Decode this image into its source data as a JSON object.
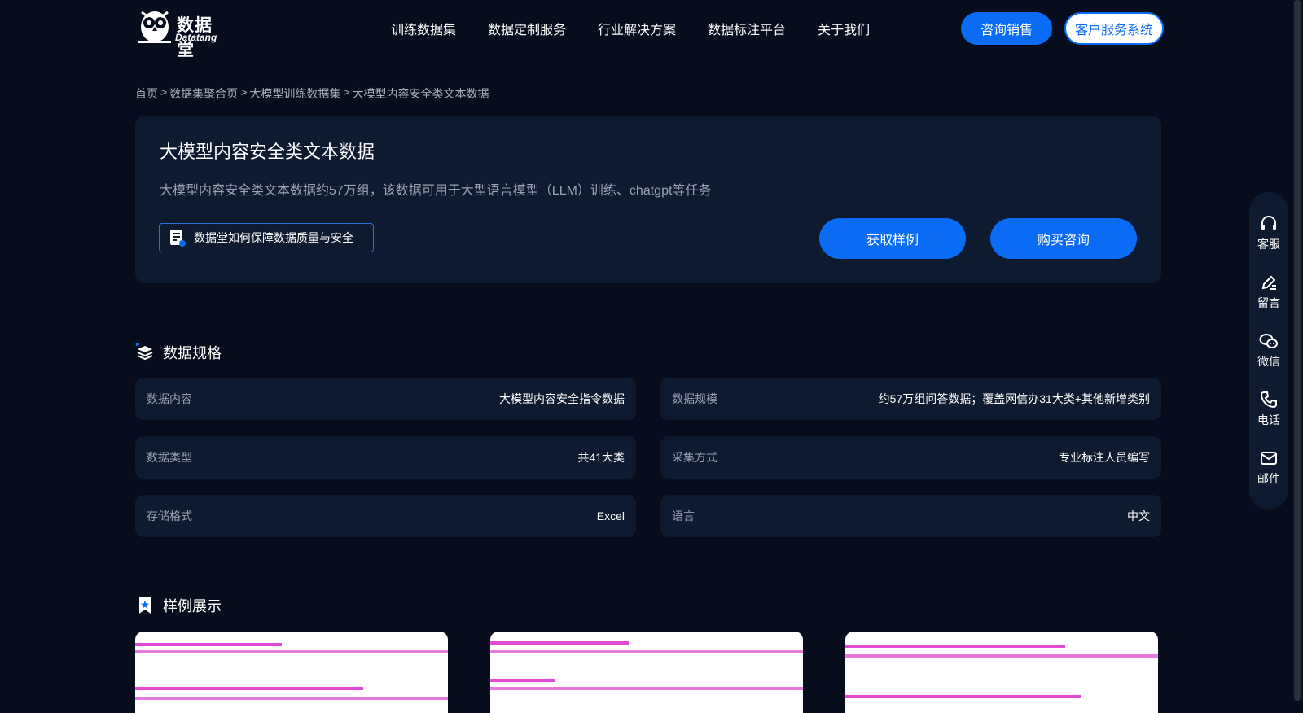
{
  "brand": {
    "name_cn": "数据堂",
    "name_en": "Datatang"
  },
  "nav": [
    "训练数据集",
    "数据定制服务",
    "行业解决方案",
    "数据标注平台",
    "关于我们"
  ],
  "header_buttons": {
    "sales": "咨询销售",
    "service": "客户服务系统"
  },
  "breadcrumb": [
    "首页",
    "数据集聚合页",
    "大模型训练数据集",
    "大模型内容安全类文本数据"
  ],
  "breadcrumb_sep": ">",
  "hero": {
    "title": "大模型内容安全类文本数据",
    "description": "大模型内容安全类文本数据约57万组，该数据可用于大型语言模型（LLM）训练、chatgpt等任务",
    "quality_link": "数据堂如何保障数据质量与安全",
    "sample_button": "获取样例",
    "buy_button": "购买咨询"
  },
  "spec": {
    "title": "数据规格",
    "items": [
      {
        "label": "数据内容",
        "value": "大模型内容安全指令数据"
      },
      {
        "label": "数据规模",
        "value": "约57万组问答数据；覆盖网信办31大类+其他新增类别"
      },
      {
        "label": "数据类型",
        "value": "共41大类"
      },
      {
        "label": "采集方式",
        "value": "专业标注人员编写"
      },
      {
        "label": "存储格式",
        "value": "Excel"
      },
      {
        "label": "语言",
        "value": "中文"
      }
    ]
  },
  "samples": {
    "title": "样例展示"
  },
  "float_bar": [
    "客服",
    "留言",
    "微信",
    "电话",
    "邮件"
  ],
  "colors": {
    "background": "#070d1c",
    "card": "#0e1a30",
    "accent": "#0a6cf5"
  }
}
